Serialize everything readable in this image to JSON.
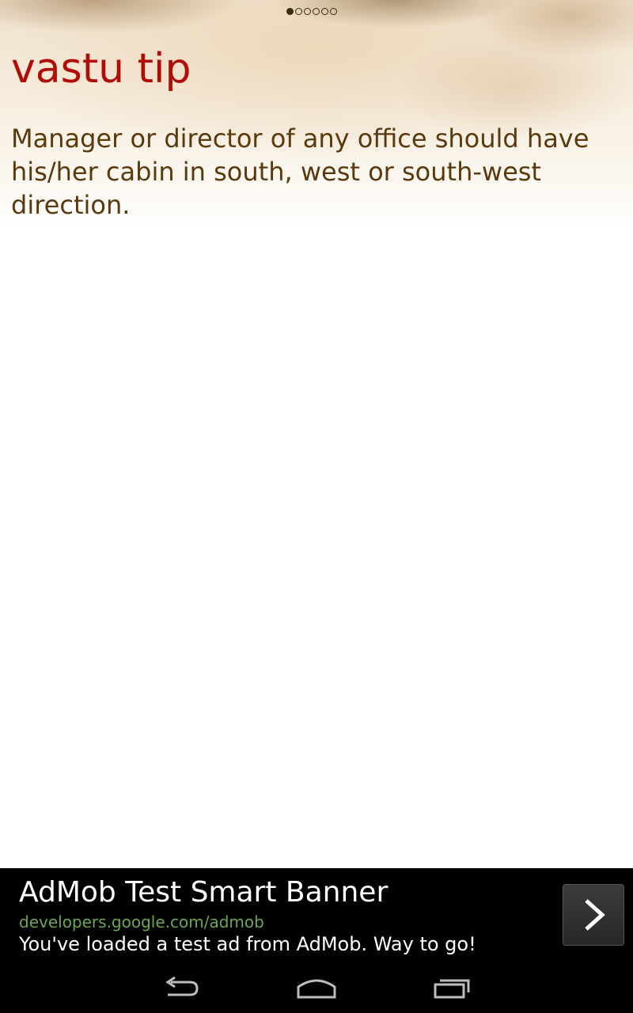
{
  "pager": {
    "total_pages": 6,
    "current_page": 1
  },
  "tip": {
    "title": "vastu tip",
    "body": "Manager or director of any office should have his/her cabin in south, west or south-west direction."
  },
  "ad": {
    "title": "AdMob Test Smart Banner",
    "url": "developers.google.com/admob",
    "description": "You've loaded a test ad from AdMob. Way to go!",
    "action_icon": "chevron-right-icon"
  },
  "nav": {
    "back_icon": "back-icon",
    "home_icon": "home-icon",
    "recent_icon": "recent-apps-icon"
  },
  "colors": {
    "title": "#b00d08",
    "body": "#5a3a0c",
    "ad_url": "#6aa84f",
    "ad_background": "#000000"
  }
}
